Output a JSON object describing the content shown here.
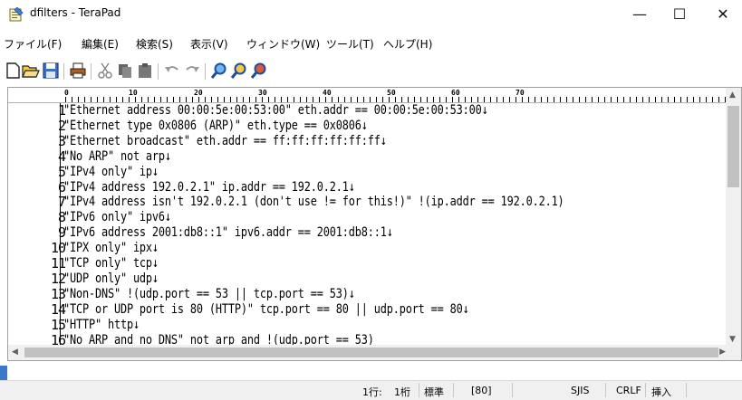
{
  "window": {
    "title": "dfilters - TeraPad",
    "minimize": "—",
    "maximize": "☐",
    "close": "✕"
  },
  "menu": [
    "ファイル(F)",
    "編集(E)",
    "検索(S)",
    "表示(V)",
    "ウィンドウ(W)",
    "ツール(T)",
    "ヘルプ(H)"
  ],
  "toolbar": {
    "icons": [
      "new-file-icon",
      "open-folder-icon",
      "save-icon",
      "print-icon",
      "cut-icon",
      "copy-icon",
      "paste-icon",
      "undo-icon",
      "redo-icon",
      "find-icon",
      "find-next-icon",
      "find-prev-icon"
    ]
  },
  "ruler": {
    "labels": [
      "0",
      "10",
      "20",
      "30",
      "40",
      "50",
      "60",
      "70"
    ]
  },
  "editor": {
    "line_numbers": [
      "1",
      "2",
      "3",
      "4",
      "5",
      "6",
      "7",
      "8",
      "9",
      "10",
      "11",
      "12",
      "13",
      "14",
      "15",
      "16"
    ],
    "lines": [
      "\"Ethernet address 00:00:5e:00:53:00\" eth.addr == 00:00:5e:00:53:00↓",
      "\"Ethernet type 0x0806 (ARP)\" eth.type == 0x0806↓",
      "\"Ethernet broadcast\" eth.addr == ff:ff:ff:ff:ff:ff↓",
      "\"No ARP\" not arp↓",
      "\"IPv4 only\" ip↓",
      "\"IPv4 address 192.0.2.1\" ip.addr == 192.0.2.1↓",
      "\"IPv4 address isn't 192.0.2.1 (don't use != for this!)\" !(ip.addr == 192.0.2.1)",
      "\"IPv6 only\" ipv6↓",
      "\"IPv6 address 2001:db8::1\" ipv6.addr == 2001:db8::1↓",
      "\"IPX only\" ipx↓",
      "\"TCP only\" tcp↓",
      "\"UDP only\" udp↓",
      "\"Non-DNS\" !(udp.port == 53 || tcp.port == 53)↓",
      "\"TCP or UDP port is 80 (HTTP)\" tcp.port == 80 || udp.port == 80↓",
      "\"HTTP\" http↓",
      "\"No ARP and no DNS\" not arp and !(udp.port == 53)"
    ]
  },
  "status": {
    "row": "1行:",
    "col": "1桁",
    "mode": "標準",
    "code": "[80]",
    "encoding": "SJIS",
    "newline": "CRLF",
    "insert": "挿入"
  }
}
